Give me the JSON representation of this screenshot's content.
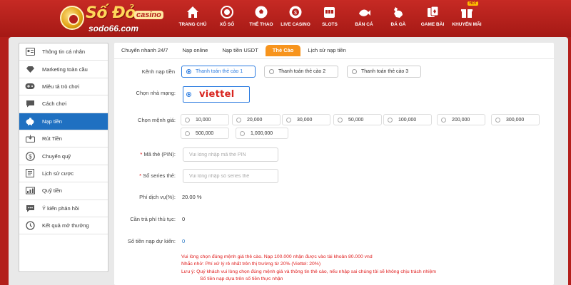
{
  "logo": {
    "name": "Số Đỏ",
    "badge": "casino",
    "site": "sodo66.com"
  },
  "nav": [
    {
      "label": "TRANG CHỦ",
      "icon": "home-icon"
    },
    {
      "label": "XỔ SỐ",
      "icon": "lottery-ball-icon"
    },
    {
      "label": "THỂ THAO",
      "icon": "soccer-ball-icon"
    },
    {
      "label": "LIVE CASINO",
      "icon": "casino-chip-icon"
    },
    {
      "label": "SLOTS",
      "icon": "slot-machine-icon"
    },
    {
      "label": "BẮN CÁ",
      "icon": "fish-icon"
    },
    {
      "label": "ĐÁ GÀ",
      "icon": "rooster-icon"
    },
    {
      "label": "GAME BÀI",
      "icon": "cards-icon"
    },
    {
      "label": "KHUYẾN MÃI",
      "icon": "gift-icon",
      "badge": "HOT"
    }
  ],
  "sidebar": {
    "items": [
      {
        "label": "Thông tin cá nhân",
        "icon": "id-card-icon"
      },
      {
        "label": "Marketing toàn cầu",
        "icon": "diamond-icon"
      },
      {
        "label": "Miêu tả trò chơi",
        "icon": "gamepad-icon"
      },
      {
        "label": "Cách chơi",
        "icon": "chat-bubble-icon"
      },
      {
        "label": "Nạp tiền",
        "icon": "piggy-bank-icon",
        "active": true
      },
      {
        "label": "Rút Tiền",
        "icon": "withdraw-icon"
      },
      {
        "label": "Chuyển quỹ",
        "icon": "dollar-circle-icon"
      },
      {
        "label": "Lịch sử cược",
        "icon": "history-list-icon"
      },
      {
        "label": "Quỹ tiền",
        "icon": "fund-icon"
      },
      {
        "label": "Ý kiến phản hồi",
        "icon": "feedback-icon"
      },
      {
        "label": "Kết quả mở thưởng",
        "icon": "clock-history-icon"
      }
    ]
  },
  "tabs": [
    {
      "label": "Chuyển nhanh 24/7"
    },
    {
      "label": "Nạp online"
    },
    {
      "label": "Nạp tiền USDT"
    },
    {
      "label": "Thẻ Cào",
      "active": true
    },
    {
      "label": "Lịch sử nạp tiền"
    }
  ],
  "form": {
    "channel_label": "Kênh nạp tiền",
    "channels": [
      "Thanh toán thẻ cào 1",
      "Thanh toán thẻ cào 2",
      "Thanh toán thẻ cào 3"
    ],
    "carrier_label": "Chọn nhà mạng:",
    "carrier": "viettel",
    "amount_label": "Chọn mệnh giá:",
    "amounts": [
      "10,000",
      "20,000",
      "30,000",
      "50,000",
      "100,000",
      "200,000",
      "300,000",
      "500,000",
      "1,000,000"
    ],
    "pin_label": "Mã thẻ (PIN):",
    "pin_placeholder": "Vui lòng nhập mã thẻ PIN",
    "serial_label": "Số series thẻ:",
    "serial_placeholder": "Vui lòng nhập số series thẻ",
    "fee_label": "Phí dịch vụ(%):",
    "fee_value": "20.00 %",
    "extra_fee_label": "Cần trả phí thủ tục:",
    "extra_fee_value": "0",
    "expected_label": "Số tiền nạp dự kiến:",
    "expected_value": "0"
  },
  "notes": [
    "Vui lòng chọn đúng mệnh giá thẻ cào. Nạp 100.000 nhận được vào tài khoản 80.000 vnd",
    "Nhắc nhở: Phí xử lý rẻ nhất trên thị trường từ 20% (Viettel: 20%)",
    "Lưu ý: Quý khách vui lòng chọn đúng mệnh giá và thông tin thẻ cào, nếu nhập sai chúng tôi sẽ không chịu trách nhiệm",
    "Số tiền nạp dựa trên số tiền thực nhận"
  ],
  "colors": {
    "header_red": "#b31f1b",
    "active_blue": "#1f70c1",
    "tab_orange": "#f7941d",
    "notice_red": "#e02020"
  }
}
